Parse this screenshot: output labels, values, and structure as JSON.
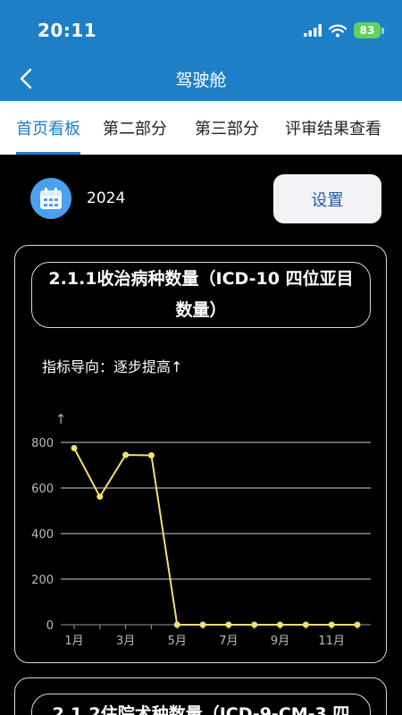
{
  "status_bar": {
    "time": "20:11",
    "battery": "83"
  },
  "nav": {
    "title": "驾驶舱"
  },
  "tabs": [
    {
      "label": "首页看板",
      "active": true
    },
    {
      "label": "第二部分",
      "active": false
    },
    {
      "label": "第三部分",
      "active": false
    },
    {
      "label": "评审结果查看",
      "active": false
    }
  ],
  "year_bar": {
    "year": "2024",
    "settings_label": "设置"
  },
  "card1": {
    "title": "2.1.1收治病种数量（ICD-10 四位亚目数量）",
    "indicator": "指标导向：逐步提高↑",
    "y_axis_arrow": "↑"
  },
  "card2": {
    "title": "2.1.2住院术种数量（ICD-9-CM-3 四"
  },
  "colors": {
    "header": "#1f7fc6",
    "line": "#f3de73",
    "battery": "#5fd35a",
    "settings_text": "#1f5fa8"
  },
  "chart_data": {
    "type": "line",
    "x": [
      "1月",
      "2月",
      "3月",
      "4月",
      "5月",
      "6月",
      "7月",
      "8月",
      "9月",
      "10月",
      "11月",
      "12月"
    ],
    "x_tick_labels": [
      "1月",
      "3月",
      "5月",
      "7月",
      "9月",
      "11月"
    ],
    "series": [
      {
        "values": [
          775,
          562,
          745,
          743,
          0,
          0,
          0,
          0,
          0,
          0,
          0,
          0
        ]
      }
    ],
    "ylim": [
      0,
      800
    ],
    "y_ticks": [
      0,
      200,
      400,
      600,
      800
    ],
    "grid": true
  }
}
